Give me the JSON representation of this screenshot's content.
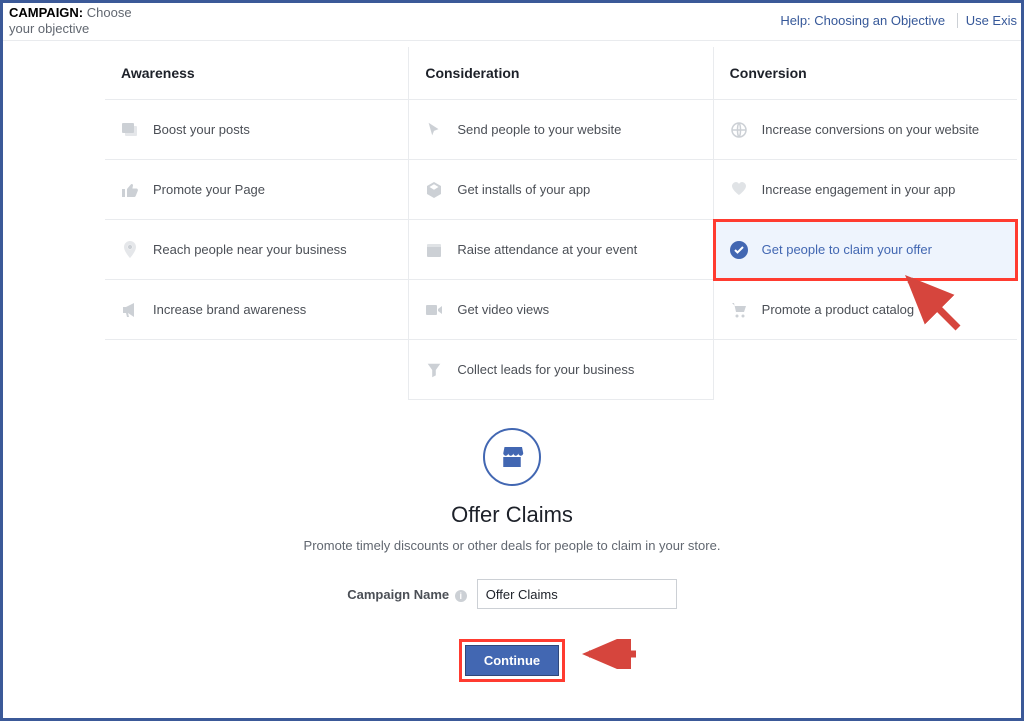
{
  "topbar": {
    "campaign_label": "CAMPAIGN:",
    "campaign_sub": "Choose your objective",
    "help_link": "Help: Choosing an Objective",
    "use_existing_link": "Use Exis"
  },
  "columns": {
    "awareness": {
      "header": "Awareness",
      "items": [
        {
          "label": "Boost your posts",
          "icon": "boost-post-icon"
        },
        {
          "label": "Promote your Page",
          "icon": "thumb-up-icon"
        },
        {
          "label": "Reach people near your business",
          "icon": "location-pin-icon"
        },
        {
          "label": "Increase brand awareness",
          "icon": "megaphone-icon"
        }
      ]
    },
    "consideration": {
      "header": "Consideration",
      "items": [
        {
          "label": "Send people to your website",
          "icon": "cursor-icon"
        },
        {
          "label": "Get installs of your app",
          "icon": "box-icon"
        },
        {
          "label": "Raise attendance at your event",
          "icon": "calendar-icon"
        },
        {
          "label": "Get video views",
          "icon": "video-icon"
        },
        {
          "label": "Collect leads for your business",
          "icon": "funnel-icon"
        }
      ]
    },
    "conversion": {
      "header": "Conversion",
      "items": [
        {
          "label": "Increase conversions on your website",
          "icon": "globe-icon",
          "selected": false
        },
        {
          "label": "Increase engagement in your app",
          "icon": "app-engage-icon",
          "selected": false
        },
        {
          "label": "Get people to claim your offer",
          "icon": "check-circle-icon",
          "selected": true
        },
        {
          "label": "Promote a product catalog",
          "icon": "cart-icon",
          "selected": false
        }
      ]
    }
  },
  "detail": {
    "title": "Offer Claims",
    "subtitle": "Promote timely discounts or other deals for people to claim in your store.",
    "campaign_name_label": "Campaign Name",
    "campaign_name_value": "Offer Claims",
    "continue_label": "Continue"
  },
  "colors": {
    "brand": "#4267b2",
    "annotation": "#ff3b30"
  }
}
